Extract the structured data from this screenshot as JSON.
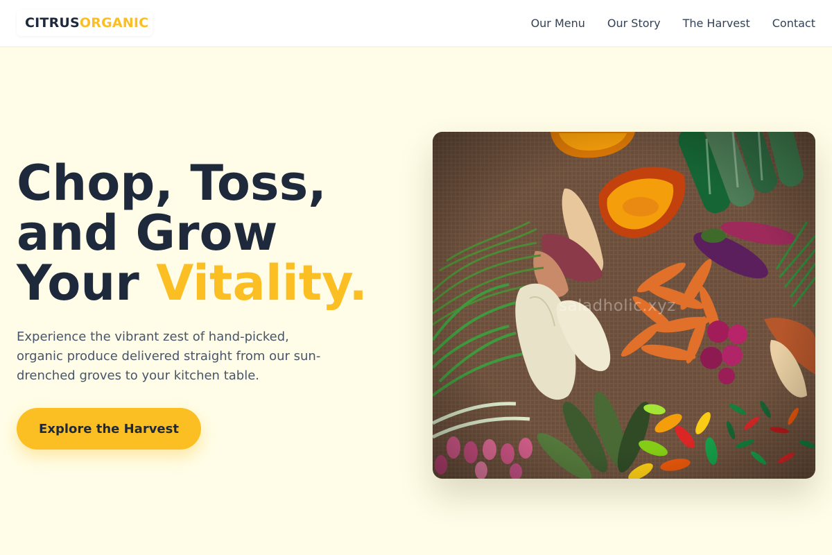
{
  "header": {
    "logo": {
      "part1": "CITRUS",
      "part2": "ORGANIC"
    },
    "nav": [
      {
        "label": "Our Menu"
      },
      {
        "label": "Our Story"
      },
      {
        "label": "The Harvest"
      },
      {
        "label": "Contact"
      }
    ]
  },
  "hero": {
    "headline": {
      "line1": "Chop, Toss,",
      "line2": "and Grow",
      "line3_plain": "Your ",
      "line3_accent": "Vitality."
    },
    "description": "Experience the vibrant zest of hand-picked, organic produce delivered straight from our sun-drenched groves to your kitchen table.",
    "cta_label": "Explore the Harvest",
    "image": {
      "watermark": "saladholic.xyz",
      "alt": "Assorted fresh vegetables on burlap"
    }
  },
  "colors": {
    "accent": "#fbbf24",
    "dark": "#1e293b",
    "background": "#fffde7"
  }
}
